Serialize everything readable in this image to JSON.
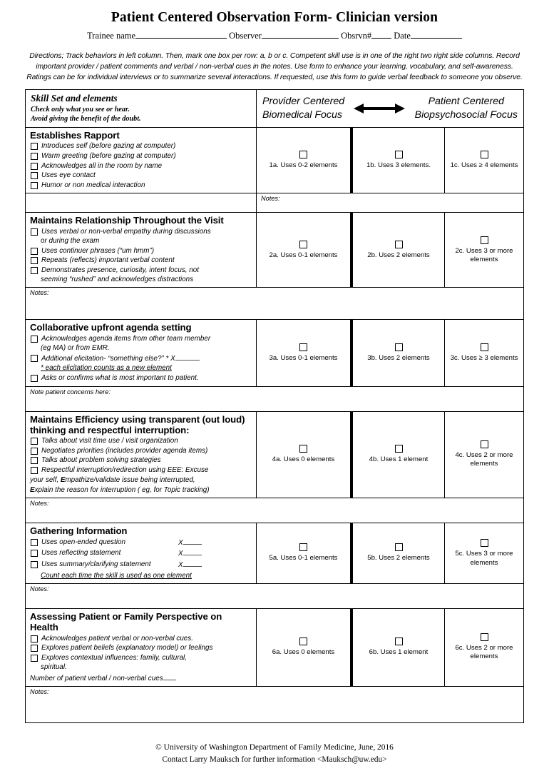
{
  "document": {
    "title": "Patient Centered Observation Form- Clinician version",
    "id_line": {
      "trainee_label": "Trainee name",
      "observer_label": "Observer",
      "obsrvn_label": "Obsrvn#",
      "date_label": "Date"
    },
    "directions": "Directions; Track behaviors in left column. Then, mark one box per row: a, b or c. Competent skill use is in one of the right two right side columns. Record important provider / patient comments and verbal / non-verbal cues in the notes. Use form to enhance your learning, vocabulary, and self-awareness. Ratings can be for individual interviews or to summarize several interactions.  If requested, use this form to guide verbal feedback to someone you observe."
  },
  "table_header": {
    "left_title": "Skill Set and elements",
    "left_sub1": "Check only what you see or hear.",
    "left_sub2": "Avoid giving the benefit of the doubt.",
    "pole_left_line1": "Provider Centered",
    "pole_left_line2": "Biomedical Focus",
    "pole_right_line1": "Patient Centered",
    "pole_right_line2": "Biopsychosocial Focus",
    "arrow_icon": "double-arrow-icon"
  },
  "sections": [
    {
      "number": 1,
      "title": "Establishes Rapport",
      "items": [
        "Introduces self (before gazing at computer)",
        "Warm greeting (before gazing at computer)",
        "Acknowledges all in the room by name",
        "Uses eye contact",
        "Humor or non medical interaction"
      ],
      "ratings": {
        "a": "1a. Uses 0-2 elements",
        "b": "1b. Uses 3 elements.",
        "c": "1c. Uses ≥ 4 elements"
      },
      "notes_label": "Notes:"
    },
    {
      "number": 2,
      "title": "Maintains Relationship Throughout the Visit",
      "items": [
        "Uses verbal or non-verbal empathy during discussions",
        "Uses continuer phrases (“um hmm”)",
        "Repeats (reflects) important verbal content",
        "Demonstrates presence, curiosity, intent focus, not"
      ],
      "continuations": {
        "after_item_1": "or during the exam",
        "after_item_4": "seeming “rushed” and acknowledges distractions"
      },
      "ratings": {
        "a": "2a.  Uses 0-1 elements",
        "b": "2b. Uses 2 elements",
        "c": "2c. Uses 3 or more elements"
      },
      "notes_label": "Notes:"
    },
    {
      "number": 3,
      "title": "Collaborative upfront agenda setting",
      "items": [
        "Acknowledges agenda items from other team member",
        "Additional elicitation- “something else?” * X",
        "Asks or confirms what is most important to patient."
      ],
      "continuations": {
        "after_item_1": "(eg MA) or from EMR.",
        "footnote": "* each elicitation counts as a new element"
      },
      "ratings": {
        "a": "3a. Uses 0-1 elements",
        "b": "3b. Uses 2 elements",
        "c": "3c. Uses ≥ 3 elements"
      },
      "notes_label": "Note patient concerns here:"
    },
    {
      "number": 4,
      "title": "Maintains Efficiency using transparent (out loud) thinking and respectful interruption:",
      "items": [
        "Talks about visit time use / visit organization",
        "Negotiates priorities (includes provider agenda items)",
        "Talks about problem solving strategies",
        "Respectful interruption/redirection using EEE: Excuse"
      ],
      "continuations": {
        "eee_line2_pre": "your self, ",
        "eee_line2_bold": "E",
        "eee_line2_post": "mpathize/validate issue being interrupted,",
        "eee_line3_bold": "E",
        "eee_line3_post": "xplain the reason for interruption ( eg, for Topic tracking)"
      },
      "ratings": {
        "a": "4a. Uses 0 elements",
        "b": "4b. Uses 1 element",
        "c": "4c. Uses 2 or more elements"
      },
      "notes_label": "Notes:"
    },
    {
      "number": 5,
      "title": "Gathering Information",
      "items": [
        "Uses  open-ended question",
        "Uses reflecting statement",
        "Uses summary/clarifying statement"
      ],
      "x_marker": "X",
      "continuations": {
        "footnote": "Count each time the skill is used as one element"
      },
      "ratings": {
        "a": "5a.  Uses 0-1 elements",
        "b": "5b. Uses 2 elements",
        "c": "5c. Uses 3 or more elements"
      },
      "notes_label": "Notes:"
    },
    {
      "number": 6,
      "title": "Assessing Patient or Family Perspective on Health",
      "items": [
        "Acknowledges patient verbal or non-verbal cues.",
        "Explores patient beliefs (explanatory model) or feelings",
        "Explores contextual influences: family, cultural,"
      ],
      "continuations": {
        "after_item_3": "spiritual.",
        "tally_line": "Number of patient verbal / non-verbal cues"
      },
      "ratings": {
        "a": "6a. Uses 0 elements",
        "b": "6b. Uses 1 element",
        "c": "6c. Uses 2 or more elements"
      },
      "notes_label": "Notes:"
    }
  ],
  "footer": {
    "line1": "© University of Washington Department of Family Medicine, June, 2016",
    "line2": "Contact Larry Mauksch for further information <Mauksch@uw.edu>"
  }
}
